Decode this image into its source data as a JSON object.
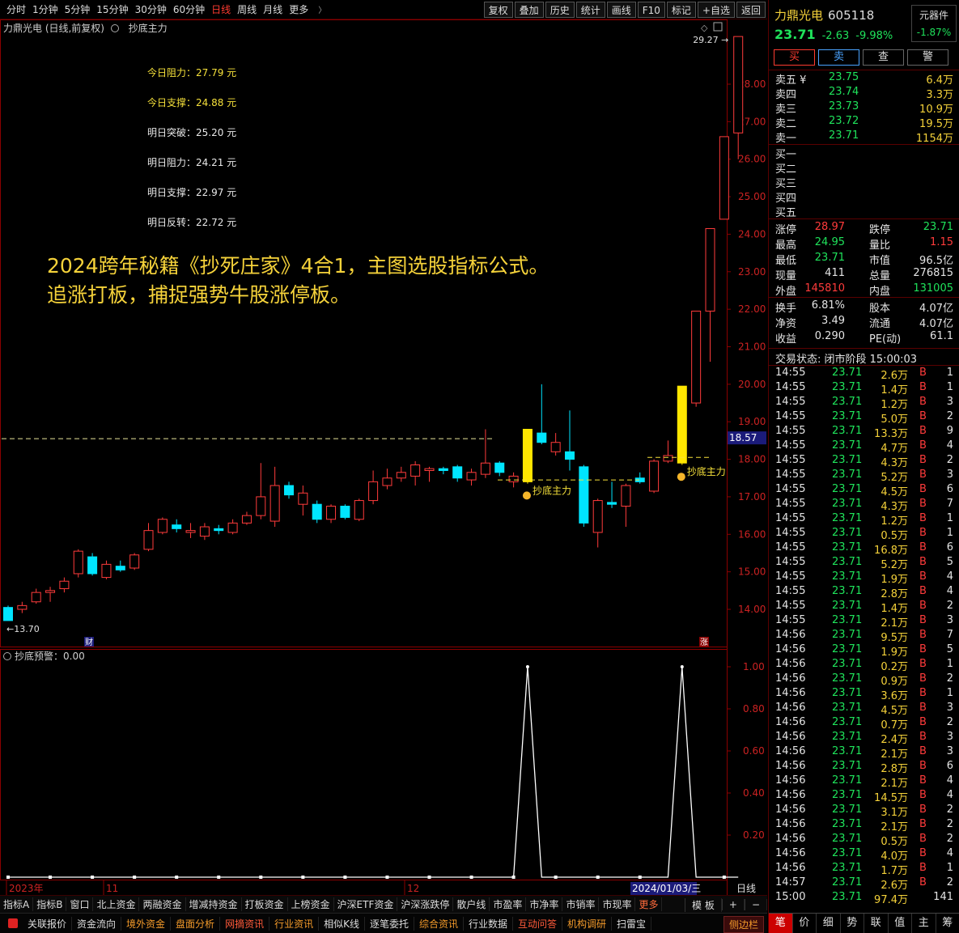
{
  "toolbar": {
    "periods": [
      "分时",
      "1分钟",
      "5分钟",
      "15分钟",
      "30分钟",
      "60分钟",
      "日线",
      "周线",
      "月线",
      "更多"
    ],
    "active_period": "日线",
    "more_chevron": "〉",
    "tools": [
      "复权",
      "叠加",
      "历史",
      "统计",
      "画线",
      "F10",
      "标记",
      "+自选",
      "返回"
    ]
  },
  "chart": {
    "title": "力鼎光电 (日线,前复权)",
    "indicator_name": "抄底主力",
    "levels": [
      {
        "label": "今日阻力：27.79 元",
        "color": "yellow"
      },
      {
        "label": "今日支撑：24.88 元",
        "color": "yellow"
      },
      {
        "label": "明日突破：25.20 元",
        "color": "white"
      },
      {
        "label": "明日阻力：24.21 元",
        "color": "white"
      },
      {
        "label": "明日支撑：22.97 元",
        "color": "white"
      },
      {
        "label": "明日反转：22.72 元",
        "color": "white"
      }
    ],
    "promo_line1": "2024跨年秘籍《抄死庄家》4合1，主图选股指标公式。",
    "promo_line2": "追涨打板，捕捉强势牛股涨停板。",
    "sub_indicator": "抄底预警：0.00",
    "signal_label": "抄底主力",
    "high_marker": "29.27",
    "low_marker": "←13.70",
    "current_price_tag": "18.57",
    "cai_tag": "财",
    "zhang_tag": "涨",
    "day_label": "日线",
    "date_tag": "2024/01/03/三",
    "x_labels": [
      "2023年",
      "11",
      "12"
    ]
  },
  "chart_data": [
    {
      "type": "candlestick",
      "title": "力鼎光电 (日线,前复权)",
      "ylim": [
        13.3,
        29.4
      ],
      "yticks": [
        14.0,
        15.0,
        16.0,
        17.0,
        18.0,
        19.0,
        20.0,
        21.0,
        22.0,
        23.0,
        24.0,
        25.0,
        26.0,
        27.0,
        28.0
      ],
      "candles": [
        {
          "o": 13.7,
          "h": 14.1,
          "l": 13.7,
          "c": 14.05,
          "color": "cyan"
        },
        {
          "o": 14.0,
          "h": 14.2,
          "l": 13.9,
          "c": 14.1,
          "color": "red"
        },
        {
          "o": 14.2,
          "h": 14.55,
          "l": 14.15,
          "c": 14.45,
          "color": "red"
        },
        {
          "o": 14.45,
          "h": 14.6,
          "l": 14.2,
          "c": 14.5,
          "color": "red"
        },
        {
          "o": 14.55,
          "h": 14.85,
          "l": 14.45,
          "c": 14.75,
          "color": "red"
        },
        {
          "o": 14.95,
          "h": 15.6,
          "l": 14.85,
          "c": 15.55,
          "color": "red"
        },
        {
          "o": 15.4,
          "h": 15.5,
          "l": 14.9,
          "c": 14.95,
          "color": "cyan"
        },
        {
          "o": 14.85,
          "h": 15.3,
          "l": 14.8,
          "c": 15.2,
          "color": "red"
        },
        {
          "o": 15.15,
          "h": 15.3,
          "l": 15.0,
          "c": 15.05,
          "color": "cyan"
        },
        {
          "o": 15.1,
          "h": 15.5,
          "l": 15.05,
          "c": 15.45,
          "color": "red"
        },
        {
          "o": 15.6,
          "h": 16.3,
          "l": 15.55,
          "c": 16.1,
          "color": "red"
        },
        {
          "o": 16.05,
          "h": 16.45,
          "l": 16.0,
          "c": 16.4,
          "color": "red"
        },
        {
          "o": 16.25,
          "h": 16.4,
          "l": 16.05,
          "c": 16.15,
          "color": "cyan"
        },
        {
          "o": 16.05,
          "h": 16.3,
          "l": 15.9,
          "c": 16.1,
          "color": "red"
        },
        {
          "o": 16.2,
          "h": 16.3,
          "l": 15.85,
          "c": 15.95,
          "color": "red"
        },
        {
          "o": 16.15,
          "h": 16.25,
          "l": 16.0,
          "c": 16.1,
          "color": "cyan"
        },
        {
          "o": 16.05,
          "h": 16.4,
          "l": 16.0,
          "c": 16.3,
          "color": "red"
        },
        {
          "o": 16.3,
          "h": 16.6,
          "l": 16.25,
          "c": 16.5,
          "color": "red"
        },
        {
          "o": 16.5,
          "h": 17.9,
          "l": 16.4,
          "c": 17.0,
          "color": "red"
        },
        {
          "o": 16.35,
          "h": 17.8,
          "l": 16.2,
          "c": 17.3,
          "color": "red"
        },
        {
          "o": 17.3,
          "h": 17.4,
          "l": 16.95,
          "c": 17.05,
          "color": "cyan"
        },
        {
          "o": 17.1,
          "h": 17.3,
          "l": 16.5,
          "c": 16.8,
          "color": "red"
        },
        {
          "o": 16.8,
          "h": 16.9,
          "l": 16.3,
          "c": 16.4,
          "color": "cyan"
        },
        {
          "o": 16.4,
          "h": 16.8,
          "l": 16.3,
          "c": 16.75,
          "color": "red"
        },
        {
          "o": 16.75,
          "h": 16.8,
          "l": 16.4,
          "c": 16.45,
          "color": "cyan"
        },
        {
          "o": 16.4,
          "h": 16.95,
          "l": 16.35,
          "c": 16.9,
          "color": "red"
        },
        {
          "o": 16.9,
          "h": 17.7,
          "l": 16.8,
          "c": 17.4,
          "color": "red"
        },
        {
          "o": 17.3,
          "h": 17.75,
          "l": 17.2,
          "c": 17.5,
          "color": "red"
        },
        {
          "o": 17.5,
          "h": 17.8,
          "l": 17.4,
          "c": 17.65,
          "color": "red"
        },
        {
          "o": 17.55,
          "h": 17.95,
          "l": 17.3,
          "c": 17.85,
          "color": "red"
        },
        {
          "o": 17.7,
          "h": 17.8,
          "l": 17.4,
          "c": 17.75,
          "color": "red"
        },
        {
          "o": 17.75,
          "h": 17.8,
          "l": 17.6,
          "c": 17.7,
          "color": "cyan"
        },
        {
          "o": 17.8,
          "h": 17.85,
          "l": 17.4,
          "c": 17.5,
          "color": "cyan"
        },
        {
          "o": 17.45,
          "h": 17.75,
          "l": 17.3,
          "c": 17.65,
          "color": "red"
        },
        {
          "o": 17.6,
          "h": 18.8,
          "l": 17.5,
          "c": 17.9,
          "color": "red"
        },
        {
          "o": 17.9,
          "h": 17.95,
          "l": 17.55,
          "c": 17.65,
          "color": "cyan"
        },
        {
          "o": 17.55,
          "h": 17.65,
          "l": 17.25,
          "c": 17.4,
          "color": "red"
        },
        {
          "o": 17.4,
          "h": 18.8,
          "l": 17.35,
          "c": 18.8,
          "color": "yellow"
        },
        {
          "o": 18.7,
          "h": 20.0,
          "l": 18.4,
          "c": 18.45,
          "color": "cyan"
        },
        {
          "o": 18.45,
          "h": 18.7,
          "l": 18.1,
          "c": 18.2,
          "color": "red"
        },
        {
          "o": 18.2,
          "h": 19.3,
          "l": 17.7,
          "c": 18.0,
          "color": "cyan"
        },
        {
          "o": 17.8,
          "h": 17.85,
          "l": 16.2,
          "c": 16.3,
          "color": "cyan"
        },
        {
          "o": 16.05,
          "h": 16.95,
          "l": 15.65,
          "c": 16.9,
          "color": "red"
        },
        {
          "o": 16.8,
          "h": 17.4,
          "l": 16.7,
          "c": 16.85,
          "color": "cyan"
        },
        {
          "o": 16.75,
          "h": 17.35,
          "l": 16.2,
          "c": 17.3,
          "color": "red"
        },
        {
          "o": 17.4,
          "h": 17.65,
          "l": 17.35,
          "c": 17.5,
          "color": "cyan"
        },
        {
          "o": 17.15,
          "h": 18.0,
          "l": 17.1,
          "c": 17.95,
          "color": "red"
        },
        {
          "o": 17.95,
          "h": 18.5,
          "l": 17.9,
          "c": 18.1,
          "color": "red"
        },
        {
          "o": 17.9,
          "h": 19.95,
          "l": 17.85,
          "c": 19.95,
          "color": "yellow"
        },
        {
          "o": 19.5,
          "h": 21.95,
          "l": 19.4,
          "c": 21.95,
          "color": "red"
        },
        {
          "o": 21.95,
          "h": 24.15,
          "l": 20.6,
          "c": 24.15,
          "color": "red"
        },
        {
          "o": 24.4,
          "h": 26.6,
          "l": 24.4,
          "c": 26.6,
          "color": "red"
        },
        {
          "o": 26.7,
          "h": 29.27,
          "l": 26.0,
          "c": 29.27,
          "color": "red"
        }
      ],
      "signal_indices": [
        37,
        48
      ]
    },
    {
      "type": "line",
      "title": "抄底预警：0.00",
      "ylim": [
        0,
        1.05
      ],
      "yticks": [
        0.2,
        0.4,
        0.6,
        0.8,
        1.0
      ],
      "values": [
        0,
        0,
        0,
        0,
        0,
        0,
        0,
        0,
        0,
        0,
        0,
        0,
        0,
        0,
        0,
        0,
        0,
        0,
        0,
        0,
        0,
        0,
        0,
        0,
        0,
        0,
        0,
        0,
        0,
        0,
        0,
        0,
        0,
        0,
        0,
        0,
        0,
        1,
        0,
        0,
        0,
        0,
        0,
        0,
        0,
        0,
        0,
        0,
        1,
        0,
        0,
        0,
        0
      ]
    }
  ],
  "right_panel": {
    "stock_name": "力鼎光电",
    "stock_code": "605118",
    "price": "23.71",
    "change": "-2.63",
    "change_pct": "-9.98%",
    "sector_name": "元器件",
    "sector_change": "-1.87%",
    "buttons": [
      "买",
      "卖",
      "查",
      "警"
    ],
    "asks": [
      {
        "label": "卖五 ¥",
        "price": "23.75",
        "vol": "6.4万"
      },
      {
        "label": "卖四",
        "price": "23.74",
        "vol": "3.3万"
      },
      {
        "label": "卖三",
        "price": "23.73",
        "vol": "10.9万"
      },
      {
        "label": "卖二",
        "price": "23.72",
        "vol": "19.5万"
      },
      {
        "label": "卖一",
        "price": "23.71",
        "vol": "1154万"
      }
    ],
    "bids": [
      "买一",
      "买二",
      "买三",
      "买四",
      "买五"
    ],
    "stats1": [
      {
        "l1": "涨停",
        "v1": "28.97",
        "c1": "red",
        "l2": "跌停",
        "v2": "23.71",
        "c2": "green"
      },
      {
        "l1": "最高",
        "v1": "24.95",
        "c1": "green",
        "l2": "量比",
        "v2": "1.15",
        "c2": "red"
      },
      {
        "l1": "最低",
        "v1": "23.71",
        "c1": "green",
        "l2": "市值",
        "v2": "96.5亿",
        "c2": "white"
      },
      {
        "l1": "现量",
        "v1": "411",
        "c1": "white",
        "l2": "总量",
        "v2": "276815",
        "c2": "white"
      },
      {
        "l1": "外盘",
        "v1": "145810",
        "c1": "red",
        "l2": "内盘",
        "v2": "131005",
        "c2": "green"
      }
    ],
    "stats2": [
      {
        "l1": "换手",
        "v1": "6.81%",
        "l2": "股本",
        "v2": "4.07亿"
      },
      {
        "l1": "净资",
        "v1": "3.49",
        "l2": "流通",
        "v2": "4.07亿"
      },
      {
        "l1": "收益",
        "v1": "0.290",
        "l2": "PE(动)",
        "v2": "61.1"
      }
    ],
    "trade_status": "交易状态: 闭市阶段 15:00:03",
    "ticks": [
      {
        "t": "14:55",
        "p": "23.71",
        "v": "2.6万",
        "f": "B",
        "n": "1"
      },
      {
        "t": "14:55",
        "p": "23.71",
        "v": "1.4万",
        "f": "B",
        "n": "1"
      },
      {
        "t": "14:55",
        "p": "23.71",
        "v": "1.2万",
        "f": "B",
        "n": "3"
      },
      {
        "t": "14:55",
        "p": "23.71",
        "v": "5.0万",
        "f": "B",
        "n": "2"
      },
      {
        "t": "14:55",
        "p": "23.71",
        "v": "13.3万",
        "f": "B",
        "n": "9"
      },
      {
        "t": "14:55",
        "p": "23.71",
        "v": "4.7万",
        "f": "B",
        "n": "4"
      },
      {
        "t": "14:55",
        "p": "23.71",
        "v": "4.3万",
        "f": "B",
        "n": "2"
      },
      {
        "t": "14:55",
        "p": "23.71",
        "v": "5.2万",
        "f": "B",
        "n": "3"
      },
      {
        "t": "14:55",
        "p": "23.71",
        "v": "4.5万",
        "f": "B",
        "n": "6"
      },
      {
        "t": "14:55",
        "p": "23.71",
        "v": "4.3万",
        "f": "B",
        "n": "7"
      },
      {
        "t": "14:55",
        "p": "23.71",
        "v": "1.2万",
        "f": "B",
        "n": "1"
      },
      {
        "t": "14:55",
        "p": "23.71",
        "v": "0.5万",
        "f": "B",
        "n": "1"
      },
      {
        "t": "14:55",
        "p": "23.71",
        "v": "16.8万",
        "f": "B",
        "n": "6"
      },
      {
        "t": "14:55",
        "p": "23.71",
        "v": "5.2万",
        "f": "B",
        "n": "5"
      },
      {
        "t": "14:55",
        "p": "23.71",
        "v": "1.9万",
        "f": "B",
        "n": "4"
      },
      {
        "t": "14:55",
        "p": "23.71",
        "v": "2.8万",
        "f": "B",
        "n": "4"
      },
      {
        "t": "14:55",
        "p": "23.71",
        "v": "1.4万",
        "f": "B",
        "n": "2"
      },
      {
        "t": "14:55",
        "p": "23.71",
        "v": "2.1万",
        "f": "B",
        "n": "3"
      },
      {
        "t": "14:56",
        "p": "23.71",
        "v": "9.5万",
        "f": "B",
        "n": "7"
      },
      {
        "t": "14:56",
        "p": "23.71",
        "v": "1.9万",
        "f": "B",
        "n": "5"
      },
      {
        "t": "14:56",
        "p": "23.71",
        "v": "0.2万",
        "f": "B",
        "n": "1"
      },
      {
        "t": "14:56",
        "p": "23.71",
        "v": "0.9万",
        "f": "B",
        "n": "2"
      },
      {
        "t": "14:56",
        "p": "23.71",
        "v": "3.6万",
        "f": "B",
        "n": "1"
      },
      {
        "t": "14:56",
        "p": "23.71",
        "v": "4.5万",
        "f": "B",
        "n": "3"
      },
      {
        "t": "14:56",
        "p": "23.71",
        "v": "0.7万",
        "f": "B",
        "n": "2"
      },
      {
        "t": "14:56",
        "p": "23.71",
        "v": "2.4万",
        "f": "B",
        "n": "3"
      },
      {
        "t": "14:56",
        "p": "23.71",
        "v": "2.1万",
        "f": "B",
        "n": "3"
      },
      {
        "t": "14:56",
        "p": "23.71",
        "v": "2.8万",
        "f": "B",
        "n": "6"
      },
      {
        "t": "14:56",
        "p": "23.71",
        "v": "2.1万",
        "f": "B",
        "n": "4"
      },
      {
        "t": "14:56",
        "p": "23.71",
        "v": "14.5万",
        "f": "B",
        "n": "4"
      },
      {
        "t": "14:56",
        "p": "23.71",
        "v": "3.1万",
        "f": "B",
        "n": "2"
      },
      {
        "t": "14:56",
        "p": "23.71",
        "v": "2.1万",
        "f": "B",
        "n": "2"
      },
      {
        "t": "14:56",
        "p": "23.71",
        "v": "0.5万",
        "f": "B",
        "n": "2"
      },
      {
        "t": "14:56",
        "p": "23.71",
        "v": "4.0万",
        "f": "B",
        "n": "4"
      },
      {
        "t": "14:56",
        "p": "23.71",
        "v": "1.7万",
        "f": "B",
        "n": "1"
      },
      {
        "t": "14:57",
        "p": "23.71",
        "v": "2.6万",
        "f": "B",
        "n": "2"
      },
      {
        "t": "15:00",
        "p": "23.71",
        "v": "97.4万",
        "f": "",
        "n": "141"
      }
    ],
    "bottom_tabs": [
      "笔",
      "价",
      "细",
      "势",
      "联",
      "值",
      "主",
      "筹"
    ]
  },
  "bottom_tabs1": [
    "指标A",
    "指标B",
    "窗口",
    "北上资金",
    "两融资金",
    "增减持资金",
    "打板资金",
    "上榜资金",
    "沪深ETF资金",
    "沪深涨跌停",
    "散户线",
    "市盈率",
    "市净率",
    "市销率",
    "市现率",
    "更多"
  ],
  "bottom_tabs1_right": [
    "模 板",
    "+",
    "−"
  ],
  "bottom_tabs2": [
    {
      "label": "关联报价",
      "c": "white"
    },
    {
      "label": "资金流向",
      "c": "white"
    },
    {
      "label": "境外资金",
      "c": "orange"
    },
    {
      "label": "盘面分析",
      "c": "orange"
    },
    {
      "label": "网摘资讯",
      "c": "red"
    },
    {
      "label": "行业资讯",
      "c": "orange"
    },
    {
      "label": "相似K线",
      "c": "white"
    },
    {
      "label": "逐笔委托",
      "c": "white"
    },
    {
      "label": "综合资讯",
      "c": "orange"
    },
    {
      "label": "行业数据",
      "c": "white"
    },
    {
      "label": "互动问答",
      "c": "red"
    },
    {
      "label": "机构调研",
      "c": "orange"
    },
    {
      "label": "扫雷宝",
      "c": "white"
    }
  ],
  "side_bar_label": "侧边栏",
  "colors": {
    "up": "#ff3b3b",
    "down": "#00e5ff",
    "signal": "#ffe600",
    "grid": "#8b0000",
    "bg": "#000000"
  }
}
